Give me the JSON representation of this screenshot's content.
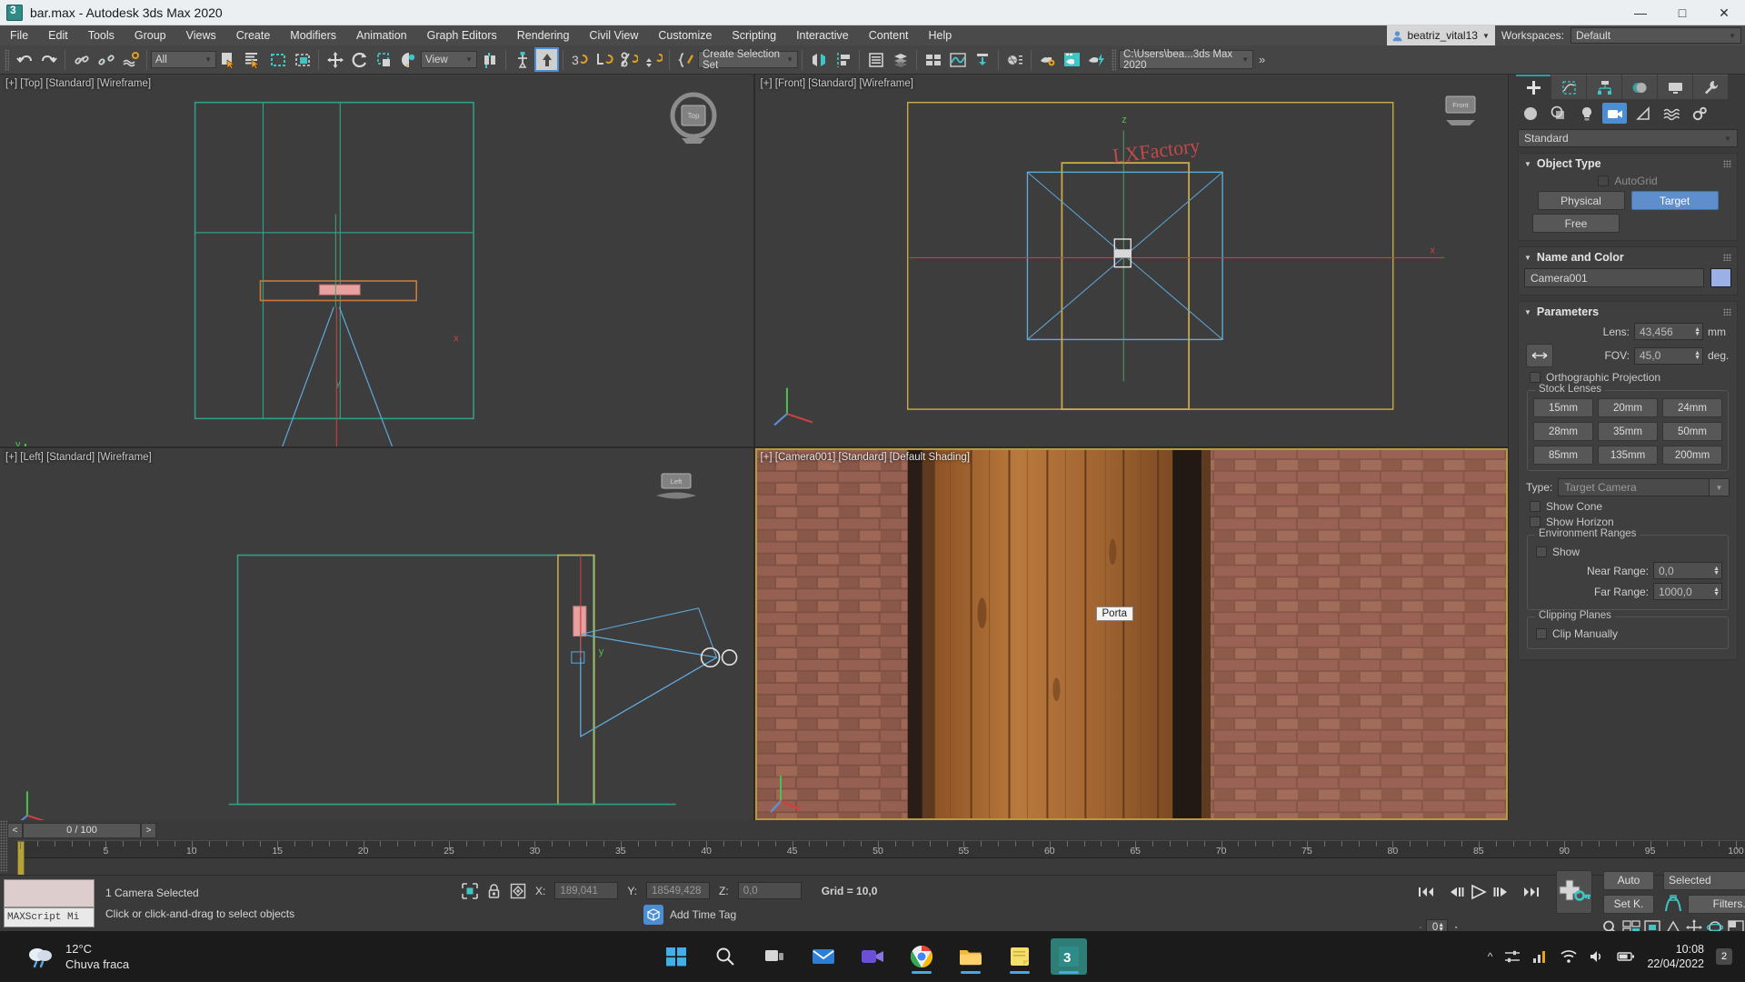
{
  "window": {
    "title": "bar.max - Autodesk 3ds Max 2020",
    "app_icon": "3dsmax-icon",
    "minimize": "—",
    "maximize": "□",
    "close": "✕"
  },
  "menu": {
    "items": [
      "File",
      "Edit",
      "Tools",
      "Group",
      "Views",
      "Create",
      "Modifiers",
      "Animation",
      "Graph Editors",
      "Rendering",
      "Civil View",
      "Customize",
      "Scripting",
      "Interactive",
      "Content",
      "Help"
    ],
    "user": "beatriz_vital13",
    "workspaces_label": "Workspaces:",
    "workspace_value": "Default"
  },
  "toolbar": {
    "selection_filter": "All",
    "reference_coord": "View",
    "named_selection_sets": "Create Selection Set",
    "project_path": "C:\\Users\\bea...3ds Max 2020",
    "overflow": "»",
    "icons": [
      "undo-icon",
      "redo-icon",
      "select-link-icon",
      "unlink-icon",
      "bind-space-warp-icon",
      "select-object-icon",
      "select-by-name-icon",
      "rectangular-region-icon",
      "window-crossing-icon",
      "select-move-icon",
      "select-rotate-icon",
      "select-scale-icon",
      "placement-icon",
      "use-center-icon",
      "use-pivot-icon",
      "select-snap-icon",
      "angle-snap-icon",
      "percent-snap-icon",
      "spinner-snap-icon",
      "edit-named-sets-icon",
      "mirror-icon",
      "align-icon",
      "layer-explorer-icon",
      "scene-explorer-icon",
      "curve-editor-icon",
      "schematic-view-icon",
      "material-editor-icon",
      "render-setup-icon",
      "rendered-frame-icon",
      "render-production-icon"
    ]
  },
  "viewports": [
    {
      "label": "[+] [Top] [Standard] [Wireframe]",
      "name": "viewport-top",
      "nav_cube": "Top"
    },
    {
      "label": "[+] [Front] [Standard] [Wireframe]",
      "name": "viewport-front",
      "nav_cube": "Front",
      "scene_text": "LXFactory"
    },
    {
      "label": "[+] [Left] [Standard] [Wireframe]",
      "name": "viewport-left",
      "nav_cube": "Left"
    },
    {
      "label": "[+] [Camera001] [Standard] [Default Shading]",
      "name": "viewport-camera",
      "object_label": "Porta"
    }
  ],
  "command_panel": {
    "tabs": [
      "create-tab",
      "modify-tab",
      "hierarchy-tab",
      "motion-tab",
      "display-tab",
      "utilities-tab"
    ],
    "selected_tab_index": 0,
    "object_category_icons": [
      "geometry-icon",
      "shapes-icon",
      "lights-icon",
      "cameras-icon",
      "helpers-icon",
      "space-warps-icon",
      "systems-icon"
    ],
    "selected_category_index": 3,
    "category_dropdown": "Standard",
    "object_type": {
      "title": "Object Type",
      "autogrid_label": "AutoGrid",
      "buttons": [
        "Physical",
        "Target",
        "Free"
      ],
      "selected_button": "Target"
    },
    "name_and_color": {
      "title": "Name and Color",
      "name": "Camera001",
      "color": "#9cb0e8"
    },
    "parameters": {
      "title": "Parameters",
      "lens_label": "Lens:",
      "lens_value": "43,456",
      "lens_unit": "mm",
      "fov_label": "FOV:",
      "fov_value": "45,0",
      "fov_unit": "deg.",
      "fov_direction_icon": "horizontal-fov-icon",
      "orthographic_label": "Orthographic Projection",
      "stock_lenses_title": "Stock Lenses",
      "stock_lenses": [
        "15mm",
        "20mm",
        "24mm",
        "28mm",
        "35mm",
        "50mm",
        "85mm",
        "135mm",
        "200mm"
      ],
      "type_label": "Type:",
      "type_value": "Target Camera",
      "show_cone_label": "Show Cone",
      "show_horizon_label": "Show Horizon",
      "environment_ranges_title": "Environment Ranges",
      "env_show_label": "Show",
      "near_range_label": "Near Range:",
      "near_range_value": "0,0",
      "far_range_label": "Far Range:",
      "far_range_value": "1000,0",
      "clipping_planes_title": "Clipping Planes",
      "clip_manually_label": "Clip Manually"
    }
  },
  "timeline": {
    "prev_frame": "<",
    "next_frame": ">",
    "frame_display": "0 / 100",
    "ruler_labels": [
      "5",
      "10",
      "15",
      "20",
      "25",
      "30",
      "35",
      "40",
      "45",
      "50",
      "55",
      "60",
      "65",
      "70",
      "75",
      "80",
      "85",
      "90",
      "95",
      "100"
    ],
    "current_frame": 0,
    "track_view_icon": "mini-curve-editor-icon"
  },
  "status": {
    "maxscript_listener_top": "",
    "maxscript_listener_label": "MAXScript Mi",
    "selection_status": "1 Camera Selected",
    "prompt": "Click or click-and-drag to select objects",
    "selection_lock_icon": "selection-lock-icon",
    "coordinate_icon": "absolute-relative-icon",
    "x_label": "X:",
    "x_value": "189,041",
    "y_label": "Y:",
    "y_value": "18549,428",
    "z_label": "Z:",
    "z_value": "0,0",
    "grid_text": "Grid = 10,0",
    "add_time_tag": "Add Time Tag",
    "time_tag_icon": "time-tag-icon"
  },
  "animation": {
    "go_to_start": "go-to-start-icon",
    "previous_frame": "previous-frame-icon",
    "play": "play-icon",
    "next_frame": "next-frame-icon",
    "go_to_end": "go-to-end-icon",
    "current_frame_field": "0",
    "time_config_icon": "time-configuration-icon",
    "set_key_icon": "set-key-icon",
    "auto_key": "Auto",
    "set_key": "Set K.",
    "key_filters": "Filters...",
    "key_mode_icon": "key-mode-icon",
    "selection_set": "Selected",
    "nav_icons": [
      "zoom-icon",
      "zoom-all-icon",
      "zoom-extents-icon",
      "field-of-view-icon",
      "pan-icon",
      "orbit-icon",
      "maximize-viewport-icon"
    ]
  },
  "taskbar": {
    "weather_temp": "12°C",
    "weather_desc": "Chuva fraca",
    "weather_icon": "rain-cloud-icon",
    "apps": [
      {
        "name": "start-button",
        "icon": "windows-logo-icon",
        "running": false
      },
      {
        "name": "search-button",
        "icon": "search-icon",
        "running": false
      },
      {
        "name": "task-view-button",
        "icon": "task-view-icon",
        "running": false
      },
      {
        "name": "mail-app",
        "icon": "mail-icon",
        "running": false
      },
      {
        "name": "video-app",
        "icon": "video-icon",
        "running": false
      },
      {
        "name": "chrome-app",
        "icon": "chrome-icon",
        "running": true
      },
      {
        "name": "explorer-app",
        "icon": "folder-icon",
        "running": true
      },
      {
        "name": "notes-app",
        "icon": "sticky-notes-icon",
        "running": true
      },
      {
        "name": "3dsmax-app",
        "icon": "3dsmax-icon",
        "running": true
      }
    ],
    "tray_icons": [
      "show-hidden-icon",
      "settings-tray-icon",
      "graph-tray-icon",
      "wifi-icon",
      "volume-icon",
      "battery-icon"
    ],
    "time": "10:08",
    "date": "22/04/2022",
    "notification_count": "2"
  }
}
